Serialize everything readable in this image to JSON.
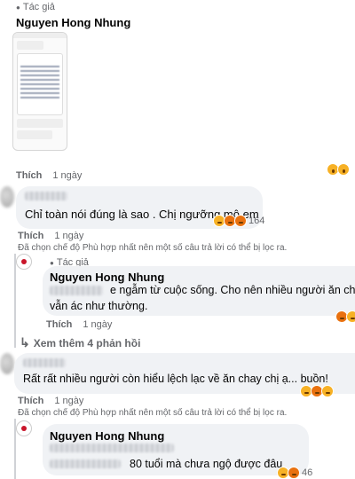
{
  "post": {
    "author_tag": "Tác giả",
    "author_name": "Nguyen Hong Nhung",
    "like_label": "Thích",
    "time": "1 ngày"
  },
  "comment1": {
    "text": "Chỉ toàn nói đúng là sao . Chị ngưỡng mộ em",
    "reaction_count": "164",
    "like_label": "Thích",
    "time": "1 ngày",
    "note": "Đã chọn chế độ Phù hợp nhất nên một số câu trả lời có thể bị lọc ra."
  },
  "reply1": {
    "author_tag": "Tác giả",
    "author_name": "Nguyen Hong Nhung",
    "text_line1": "e ngẫm từ cuộc sống. Cho nên nhiều người ăn cha",
    "text_line2": "vẫn ác như thường.",
    "like_label": "Thích",
    "time": "1 ngày",
    "more_replies": "Xem thêm 4 phản hồi"
  },
  "comment2": {
    "text": "Rất rất nhiều người còn hiểu lệch lạc về ăn chay chị ạ... buồn!",
    "like_label": "Thích",
    "time": "1 ngày",
    "note": "Đã chọn chế độ Phù hợp nhất nên một số câu trả lời có thể bị lọc ra."
  },
  "reply2": {
    "author_tag": "Tác giả",
    "author_name": "Nguyen Hong Nhung",
    "text": "80 tuổi mà chưa ngộ được đâu",
    "reaction_count": "46"
  }
}
